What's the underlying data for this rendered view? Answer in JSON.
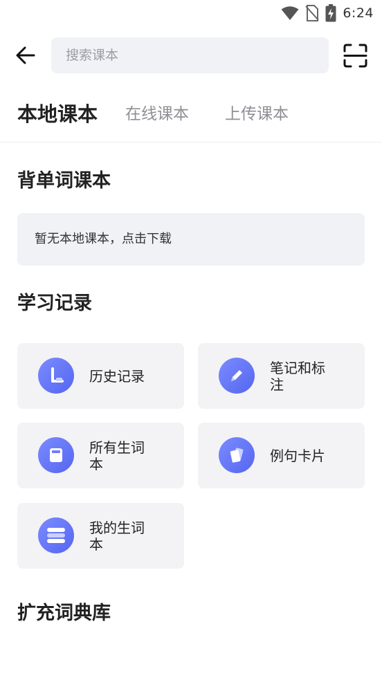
{
  "status_bar": {
    "time": "6:24"
  },
  "search": {
    "placeholder": "搜索课本",
    "value": ""
  },
  "tabs": [
    {
      "label": "本地课本",
      "active": true
    },
    {
      "label": "在线课本",
      "active": false
    },
    {
      "label": "上传课本",
      "active": false
    }
  ],
  "sections": {
    "vocab_books": {
      "title": "背单词课本",
      "empty_text": "暂无本地课本，点击下载"
    },
    "study_records": {
      "title": "学习记录",
      "items": [
        {
          "label": "历史记录",
          "icon": "clock-icon"
        },
        {
          "label": "笔记和标注",
          "icon": "pencil-icon"
        },
        {
          "label": "所有生词本",
          "icon": "wordbook-icon"
        },
        {
          "label": "例句卡片",
          "icon": "cards-icon"
        },
        {
          "label": "我的生词本",
          "icon": "list-icon"
        }
      ]
    },
    "dictionaries": {
      "title": "扩充词典库"
    }
  },
  "colors": {
    "accent": "#5e6ef5",
    "card_bg": "#f3f3f5",
    "search_bg": "#f1f2f6"
  }
}
